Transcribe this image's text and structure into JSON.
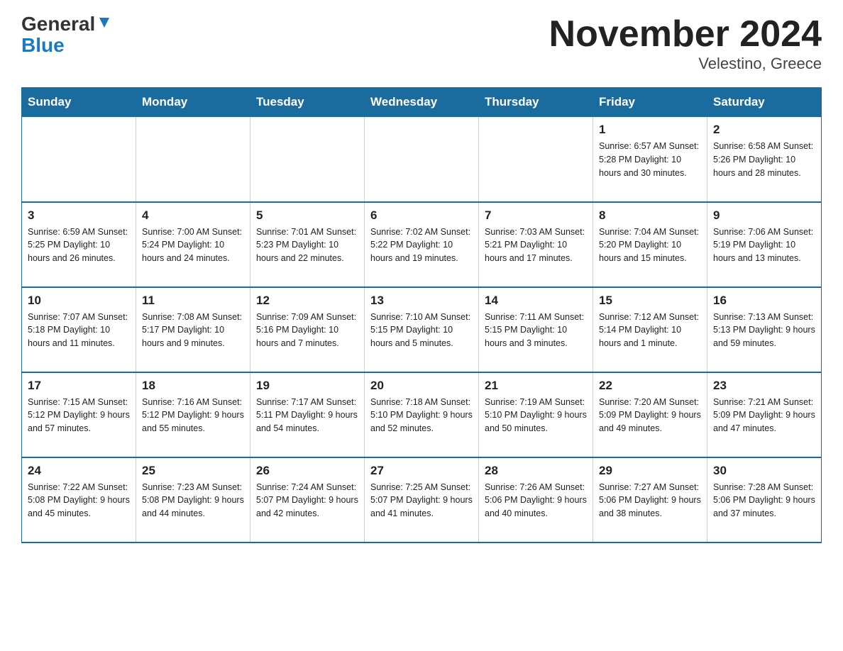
{
  "header": {
    "logo_general": "General",
    "logo_blue": "Blue",
    "title": "November 2024",
    "subtitle": "Velestino, Greece"
  },
  "weekdays": [
    "Sunday",
    "Monday",
    "Tuesday",
    "Wednesday",
    "Thursday",
    "Friday",
    "Saturday"
  ],
  "rows": [
    [
      {
        "day": "",
        "info": ""
      },
      {
        "day": "",
        "info": ""
      },
      {
        "day": "",
        "info": ""
      },
      {
        "day": "",
        "info": ""
      },
      {
        "day": "",
        "info": ""
      },
      {
        "day": "1",
        "info": "Sunrise: 6:57 AM\nSunset: 5:28 PM\nDaylight: 10 hours\nand 30 minutes."
      },
      {
        "day": "2",
        "info": "Sunrise: 6:58 AM\nSunset: 5:26 PM\nDaylight: 10 hours\nand 28 minutes."
      }
    ],
    [
      {
        "day": "3",
        "info": "Sunrise: 6:59 AM\nSunset: 5:25 PM\nDaylight: 10 hours\nand 26 minutes."
      },
      {
        "day": "4",
        "info": "Sunrise: 7:00 AM\nSunset: 5:24 PM\nDaylight: 10 hours\nand 24 minutes."
      },
      {
        "day": "5",
        "info": "Sunrise: 7:01 AM\nSunset: 5:23 PM\nDaylight: 10 hours\nand 22 minutes."
      },
      {
        "day": "6",
        "info": "Sunrise: 7:02 AM\nSunset: 5:22 PM\nDaylight: 10 hours\nand 19 minutes."
      },
      {
        "day": "7",
        "info": "Sunrise: 7:03 AM\nSunset: 5:21 PM\nDaylight: 10 hours\nand 17 minutes."
      },
      {
        "day": "8",
        "info": "Sunrise: 7:04 AM\nSunset: 5:20 PM\nDaylight: 10 hours\nand 15 minutes."
      },
      {
        "day": "9",
        "info": "Sunrise: 7:06 AM\nSunset: 5:19 PM\nDaylight: 10 hours\nand 13 minutes."
      }
    ],
    [
      {
        "day": "10",
        "info": "Sunrise: 7:07 AM\nSunset: 5:18 PM\nDaylight: 10 hours\nand 11 minutes."
      },
      {
        "day": "11",
        "info": "Sunrise: 7:08 AM\nSunset: 5:17 PM\nDaylight: 10 hours\nand 9 minutes."
      },
      {
        "day": "12",
        "info": "Sunrise: 7:09 AM\nSunset: 5:16 PM\nDaylight: 10 hours\nand 7 minutes."
      },
      {
        "day": "13",
        "info": "Sunrise: 7:10 AM\nSunset: 5:15 PM\nDaylight: 10 hours\nand 5 minutes."
      },
      {
        "day": "14",
        "info": "Sunrise: 7:11 AM\nSunset: 5:15 PM\nDaylight: 10 hours\nand 3 minutes."
      },
      {
        "day": "15",
        "info": "Sunrise: 7:12 AM\nSunset: 5:14 PM\nDaylight: 10 hours\nand 1 minute."
      },
      {
        "day": "16",
        "info": "Sunrise: 7:13 AM\nSunset: 5:13 PM\nDaylight: 9 hours\nand 59 minutes."
      }
    ],
    [
      {
        "day": "17",
        "info": "Sunrise: 7:15 AM\nSunset: 5:12 PM\nDaylight: 9 hours\nand 57 minutes."
      },
      {
        "day": "18",
        "info": "Sunrise: 7:16 AM\nSunset: 5:12 PM\nDaylight: 9 hours\nand 55 minutes."
      },
      {
        "day": "19",
        "info": "Sunrise: 7:17 AM\nSunset: 5:11 PM\nDaylight: 9 hours\nand 54 minutes."
      },
      {
        "day": "20",
        "info": "Sunrise: 7:18 AM\nSunset: 5:10 PM\nDaylight: 9 hours\nand 52 minutes."
      },
      {
        "day": "21",
        "info": "Sunrise: 7:19 AM\nSunset: 5:10 PM\nDaylight: 9 hours\nand 50 minutes."
      },
      {
        "day": "22",
        "info": "Sunrise: 7:20 AM\nSunset: 5:09 PM\nDaylight: 9 hours\nand 49 minutes."
      },
      {
        "day": "23",
        "info": "Sunrise: 7:21 AM\nSunset: 5:09 PM\nDaylight: 9 hours\nand 47 minutes."
      }
    ],
    [
      {
        "day": "24",
        "info": "Sunrise: 7:22 AM\nSunset: 5:08 PM\nDaylight: 9 hours\nand 45 minutes."
      },
      {
        "day": "25",
        "info": "Sunrise: 7:23 AM\nSunset: 5:08 PM\nDaylight: 9 hours\nand 44 minutes."
      },
      {
        "day": "26",
        "info": "Sunrise: 7:24 AM\nSunset: 5:07 PM\nDaylight: 9 hours\nand 42 minutes."
      },
      {
        "day": "27",
        "info": "Sunrise: 7:25 AM\nSunset: 5:07 PM\nDaylight: 9 hours\nand 41 minutes."
      },
      {
        "day": "28",
        "info": "Sunrise: 7:26 AM\nSunset: 5:06 PM\nDaylight: 9 hours\nand 40 minutes."
      },
      {
        "day": "29",
        "info": "Sunrise: 7:27 AM\nSunset: 5:06 PM\nDaylight: 9 hours\nand 38 minutes."
      },
      {
        "day": "30",
        "info": "Sunrise: 7:28 AM\nSunset: 5:06 PM\nDaylight: 9 hours\nand 37 minutes."
      }
    ]
  ]
}
